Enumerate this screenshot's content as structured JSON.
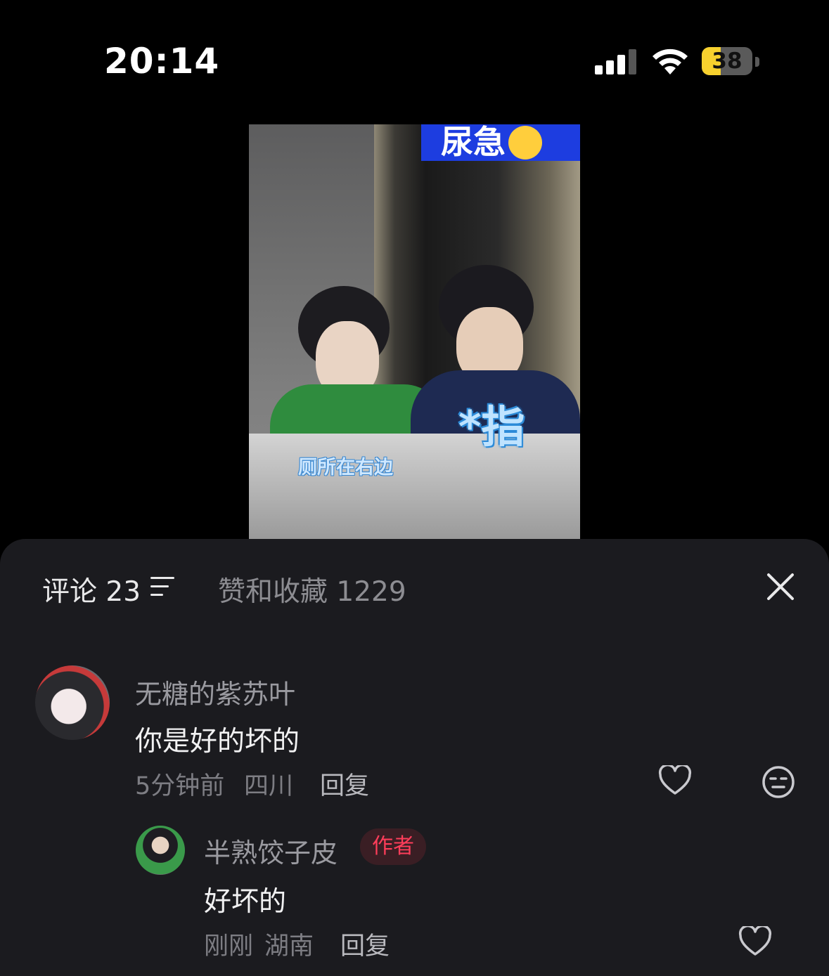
{
  "status_bar": {
    "time": "20:14",
    "battery": "38",
    "battery_fraction": 0.38
  },
  "video": {
    "banner_text": "尿急",
    "banner_emoji": "loudly-crying-face-emoji",
    "point_caption": "*指",
    "toilet_caption": "厕所在右边"
  },
  "sheet": {
    "tab_comments": "评论 23",
    "tab_likes": "赞和收藏 1229",
    "sort_icon": "sort-lines-icon",
    "close_icon": "close-x-icon"
  },
  "comments": [
    {
      "username": "无糖的紫苏叶",
      "text": "你是好的坏的",
      "time": "5分钟前",
      "location": "四川",
      "reply_label": "回复"
    },
    {
      "username": "半熟饺子皮",
      "badge": "作者",
      "text": "好坏的",
      "time": "刚刚",
      "location": "湖南",
      "reply_label": "回复"
    }
  ],
  "colors": {
    "accent_badge": "#ff3d5a",
    "sheet_bg": "#1b1b1f",
    "battery": "#f7d12e"
  }
}
